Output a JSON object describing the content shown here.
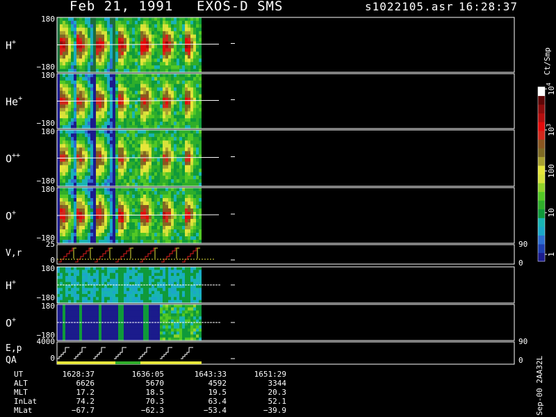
{
  "header": {
    "date": "Feb 21, 1991",
    "instrument": "EXOS-D SMS",
    "file": "s1022105.asr",
    "time": "16:28:37"
  },
  "colorbar": {
    "title": "Ct/Smp",
    "ticks": [
      "1",
      "10",
      "100",
      "10",
      "10"
    ],
    "tick_exponents": [
      "",
      "",
      "",
      "3",
      "4"
    ],
    "colors": [
      "#1b1b8c",
      "#1e3fb0",
      "#2d6ed0",
      "#1aa8c8",
      "#18b4b4",
      "#0f9a3a",
      "#2fae2a",
      "#52c825",
      "#8fd22a",
      "#d6e23a",
      "#e6e63a",
      "#a8a030",
      "#7e6a24",
      "#8a5620",
      "#d2281c",
      "#e40a0a",
      "#b40e0e",
      "#8c0c0c",
      "#5e0606",
      "#ffffff"
    ]
  },
  "chart_data": {
    "type": "heatmap",
    "ion_panels": [
      {
        "label": "H",
        "sup": "+",
        "ymax": "180",
        "ymin": "−180"
      },
      {
        "label": "He",
        "sup": "+",
        "ymax": "180",
        "ymin": "−180"
      },
      {
        "label": "O",
        "sup": "++",
        "ymax": "180",
        "ymin": "−180"
      },
      {
        "label": "O",
        "sup": "+",
        "ymax": "180",
        "ymin": "−180"
      }
    ],
    "vr_panel": {
      "label": "V,r",
      "left_ticks": [
        "25",
        "0"
      ],
      "right_ticks": [
        "90",
        "0"
      ]
    },
    "ion_panels_2": [
      {
        "label": "H",
        "sup": "+",
        "ymax": "180",
        "ymin": "−180"
      },
      {
        "label": "O",
        "sup": "+",
        "ymax": "180",
        "ymin": "−180"
      }
    ],
    "ep_panel": {
      "label1": "E,p",
      "label2": "QA",
      "left_ticks": [
        "4000",
        "0"
      ],
      "right_ticks": [
        "90",
        "0"
      ]
    },
    "x_ticks": [
      "1628:37",
      "1636:05",
      "1643:33",
      "1651:29"
    ]
  },
  "footer": {
    "rows": [
      {
        "label": "UT",
        "values": [
          "1628:37",
          "1636:05",
          "1643:33",
          "1651:29"
        ]
      },
      {
        "label": "ALT",
        "values": [
          "6626",
          "5670",
          "4592",
          "3344"
        ]
      },
      {
        "label": "MLT",
        "values": [
          "17.2",
          "18.5",
          "19.5",
          "20.3"
        ]
      },
      {
        "label": "InLat",
        "values": [
          "74.2",
          "70.3",
          "63.4",
          "52.1"
        ]
      },
      {
        "label": "MLat",
        "values": [
          "−67.7",
          "−62.3",
          "−53.4",
          "−39.9"
        ]
      }
    ],
    "stamp": "Sep-00 2AA32L"
  }
}
